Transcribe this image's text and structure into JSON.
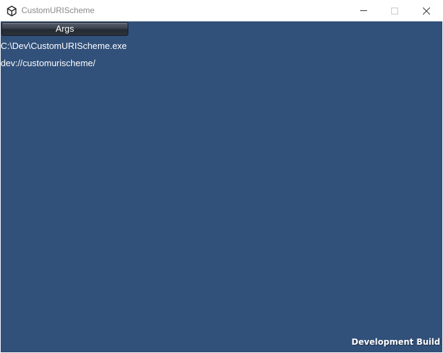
{
  "window": {
    "title": "CustomURIScheme",
    "controls": {
      "minimize_icon": "minimize-icon",
      "maximize_icon": "maximize-icon",
      "close_icon": "close-icon"
    }
  },
  "app": {
    "args_button_label": "Args",
    "lines": [
      "C:\\Dev\\CustomURIScheme.exe",
      "dev://customurischeme/"
    ],
    "watermark": "Development Build"
  },
  "colors": {
    "background": "#31507a",
    "text": "#ffffff"
  }
}
